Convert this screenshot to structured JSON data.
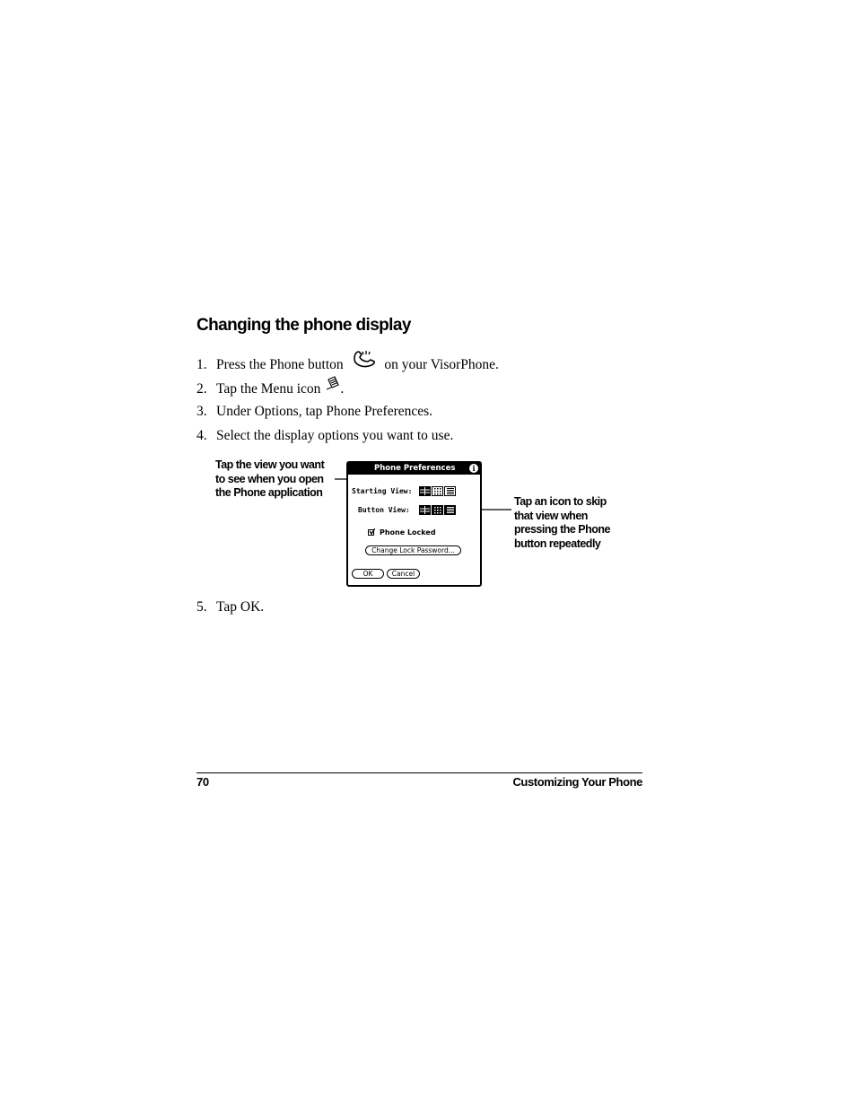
{
  "section": {
    "heading": "Changing the phone display"
  },
  "steps": [
    {
      "num": "1.",
      "text_before": "Press the Phone button",
      "text_after": "on your VisorPhone.",
      "icon": "phone-button-icon"
    },
    {
      "num": "2.",
      "text_before": "Tap the Menu icon",
      "text_after": ".",
      "icon": "menu-icon"
    },
    {
      "num": "3.",
      "text": "Under Options, tap Phone Preferences."
    },
    {
      "num": "4.",
      "text": "Select the display options you want to use."
    },
    {
      "num": "5.",
      "text": "Tap OK."
    }
  ],
  "callouts": {
    "left": [
      "Tap the view you want",
      "to see when you open",
      "the Phone application"
    ],
    "right": [
      "Tap an icon to skip",
      "that view when",
      "pressing the Phone",
      "button repeatedly"
    ]
  },
  "dialog": {
    "title": "Phone Preferences",
    "info_glyph": "i",
    "starting_view_label": "Starting View:",
    "button_view_label": "Button View:",
    "phone_locked_label": "Phone Locked",
    "phone_locked_checked": true,
    "change_lock_button": "Change Lock Password...",
    "ok_button": "OK",
    "cancel_button": "Cancel"
  },
  "footer": {
    "page_number": "70",
    "chapter_title": "Customizing Your Phone"
  }
}
